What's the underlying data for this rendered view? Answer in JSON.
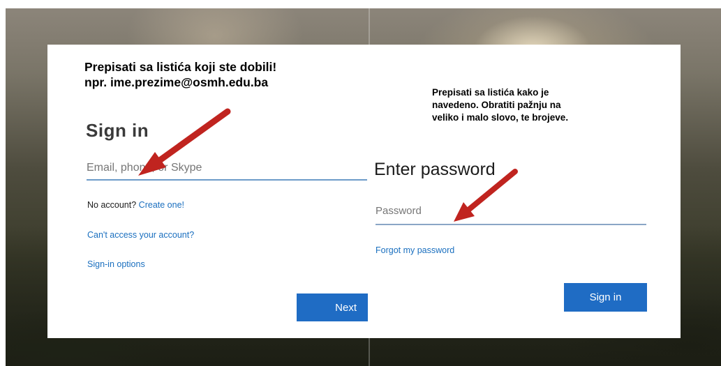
{
  "left_panel": {
    "note": "Prepisati sa listića koji ste dobili! npr. ime.prezime@osmh.edu.ba",
    "title": "Sign in",
    "email_placeholder": "Email, phone, or Skype",
    "no_account_text": "No account?",
    "create_link": "Create one!",
    "cant_access_link": "Can't access your account?",
    "signin_options_link": "Sign-in options",
    "next_label": "Next"
  },
  "right_panel": {
    "note": "Prepisati sa listića kako je navedeno. Obratiti pažnju na veliko i malo slovo, te brojeve.",
    "title": "Enter password",
    "password_placeholder": "Password",
    "forgot_link": "Forgot my password",
    "signin_label": "Sign in"
  },
  "colors": {
    "accent": "#1f6cc4",
    "link": "#1a6fbf",
    "arrow": "#c0241f"
  },
  "icons": [
    "arrow-icon"
  ]
}
